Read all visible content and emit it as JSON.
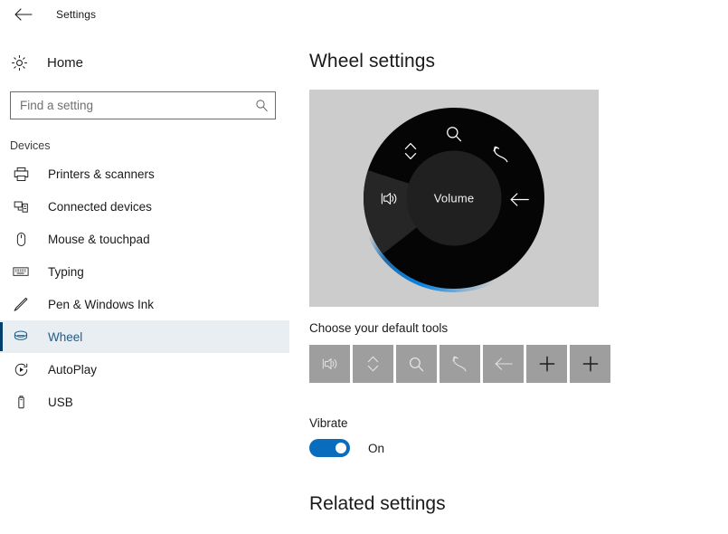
{
  "window": {
    "title": "Settings",
    "back_icon": "back-arrow-icon"
  },
  "sidebar": {
    "home": {
      "label": "Home",
      "icon": "gear-icon"
    },
    "search": {
      "value": "",
      "placeholder": "Find a setting",
      "icon": "search-icon"
    },
    "group_label": "Devices",
    "items": [
      {
        "label": "Printers & scanners",
        "icon": "printer-icon",
        "selected": false
      },
      {
        "label": "Connected devices",
        "icon": "connected-devices-icon",
        "selected": false
      },
      {
        "label": "Mouse & touchpad",
        "icon": "mouse-icon",
        "selected": false
      },
      {
        "label": "Typing",
        "icon": "keyboard-icon",
        "selected": false
      },
      {
        "label": "Pen & Windows Ink",
        "icon": "pen-icon",
        "selected": false
      },
      {
        "label": "Wheel",
        "icon": "wheel-icon",
        "selected": true
      },
      {
        "label": "AutoPlay",
        "icon": "autoplay-icon",
        "selected": false
      },
      {
        "label": "USB",
        "icon": "usb-icon",
        "selected": false
      }
    ]
  },
  "main": {
    "page_title": "Wheel settings",
    "wheel_preview": {
      "center_label": "Volume",
      "background_color": "#cccccc",
      "highlight_color": "#0a84e0",
      "active_slot": "volume",
      "slots": [
        {
          "name": "volume",
          "icon": "volume-icon",
          "angle": 180
        },
        {
          "name": "scroll",
          "icon": "scroll-updown-icon",
          "angle": 232
        },
        {
          "name": "zoom",
          "icon": "search-icon",
          "angle": 280
        },
        {
          "name": "undo",
          "icon": "undo-icon",
          "angle": 324
        },
        {
          "name": "back",
          "icon": "back-arrow-icon",
          "angle": 10
        }
      ]
    },
    "tools_section": {
      "label": "Choose your default tools",
      "tools": [
        {
          "name": "volume-tool",
          "icon": "volume-icon"
        },
        {
          "name": "scroll-tool",
          "icon": "scroll-updown-icon"
        },
        {
          "name": "zoom-tool",
          "icon": "search-icon"
        },
        {
          "name": "undo-tool",
          "icon": "undo-icon"
        },
        {
          "name": "back-tool",
          "icon": "back-arrow-icon"
        },
        {
          "name": "add-tool-1",
          "icon": "plus-icon"
        },
        {
          "name": "add-tool-2",
          "icon": "plus-icon"
        }
      ]
    },
    "vibrate": {
      "label": "Vibrate",
      "state": "On",
      "enabled": true,
      "accent_color": "#0a6cbd"
    },
    "related_settings_title": "Related settings"
  }
}
